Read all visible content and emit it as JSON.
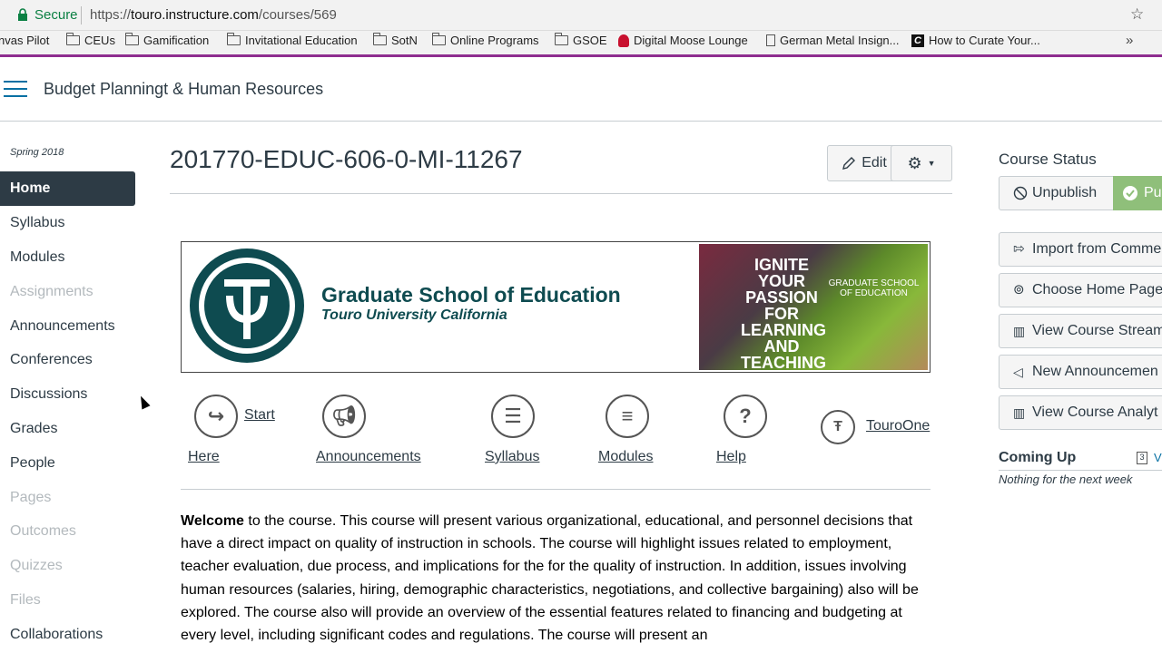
{
  "browser": {
    "secure_label": "Secure",
    "url_prefix": "https://",
    "url_host": "touro.instructure.com",
    "url_path": "/courses/569",
    "bookmarks": [
      {
        "label": "nvas Pilot",
        "icon": "none"
      },
      {
        "label": "CEUs",
        "icon": "folder-icon"
      },
      {
        "label": "Gamification",
        "icon": "folder-icon"
      },
      {
        "label": "Invitational Education",
        "icon": "folder-icon"
      },
      {
        "label": "SotN",
        "icon": "folder-icon"
      },
      {
        "label": "Online Programs",
        "icon": "folder-icon"
      },
      {
        "label": "GSOE",
        "icon": "folder-icon"
      },
      {
        "label": "Digital Moose Lounge",
        "icon": "moose-icon"
      },
      {
        "label": "German Metal Insign...",
        "icon": "page-icon"
      },
      {
        "label": "How to Curate Your...",
        "icon": "canvas-icon"
      }
    ],
    "more": "»"
  },
  "header": {
    "breadcrumb": "Budget Planningt & Human Resources",
    "accent_color": "#8e2d8f"
  },
  "nav": {
    "term": "Spring 2018",
    "items": [
      {
        "label": "Home",
        "state": "active"
      },
      {
        "label": "Syllabus",
        "state": "enabled"
      },
      {
        "label": "Modules",
        "state": "enabled"
      },
      {
        "label": "Assignments",
        "state": "disabled"
      },
      {
        "label": "Announcements",
        "state": "enabled"
      },
      {
        "label": "Conferences",
        "state": "enabled"
      },
      {
        "label": "Discussions",
        "state": "enabled"
      },
      {
        "label": "Grades",
        "state": "enabled"
      },
      {
        "label": "People",
        "state": "enabled"
      },
      {
        "label": "Pages",
        "state": "disabled"
      },
      {
        "label": "Outcomes",
        "state": "disabled"
      },
      {
        "label": "Quizzes",
        "state": "disabled"
      },
      {
        "label": "Files",
        "state": "disabled"
      },
      {
        "label": "Collaborations",
        "state": "enabled"
      }
    ]
  },
  "main": {
    "title": "201770-EDUC-606-0-MI-11267",
    "edit_label": "Edit",
    "banner": {
      "line1": "Graduate School of Education",
      "line2": "Touro University California",
      "image_text": "IGNITE YOUR PASSION FOR LEARNING AND TEACHING",
      "image_caption": "GRADUATE SCHOOL OF EDUCATION"
    },
    "quick_links": [
      {
        "label": "Start",
        "label2": "Here",
        "icon": "start-icon"
      },
      {
        "label": "Announcements",
        "icon": "megaphone-icon"
      },
      {
        "label": "Syllabus",
        "icon": "syllabus-icon"
      },
      {
        "label": "Modules",
        "icon": "modules-icon"
      },
      {
        "label": "Help",
        "icon": "help-icon"
      },
      {
        "label": "TouroOne",
        "icon": "touroone-icon"
      }
    ],
    "welcome_bold": "Welcome",
    "welcome_text": " to the course. This course will present various organizational, educational, and personnel decisions that have a direct impact on quality of instruction in schools. The course will highlight issues related to employment, teacher evaluation, due process, and implications for the for the quality of instruction. In addition, issues involving human resources (salaries, hiring, demographic characteristics, negotiations, and collective bargaining) also will be explored. The course also will provide an overview of the essential features related to financing and budgeting at every level, including significant codes and regulations. The course will present an"
  },
  "sidebar": {
    "status_title": "Course Status",
    "unpublish_label": "Unpublish",
    "publish_label": "Pu",
    "actions": [
      {
        "label": "Import from Comme",
        "icon": "import-icon"
      },
      {
        "label": "Choose Home Page",
        "icon": "target-icon"
      },
      {
        "label": "View Course Stream",
        "icon": "stream-icon"
      },
      {
        "label": "New Announcemen",
        "icon": "announcement-icon"
      },
      {
        "label": "View Course Analyt",
        "icon": "analytics-icon"
      }
    ],
    "coming_up_title": "Coming Up",
    "calendar_day": "3",
    "view_link": "V",
    "nothing_text": "Nothing for the next week"
  }
}
